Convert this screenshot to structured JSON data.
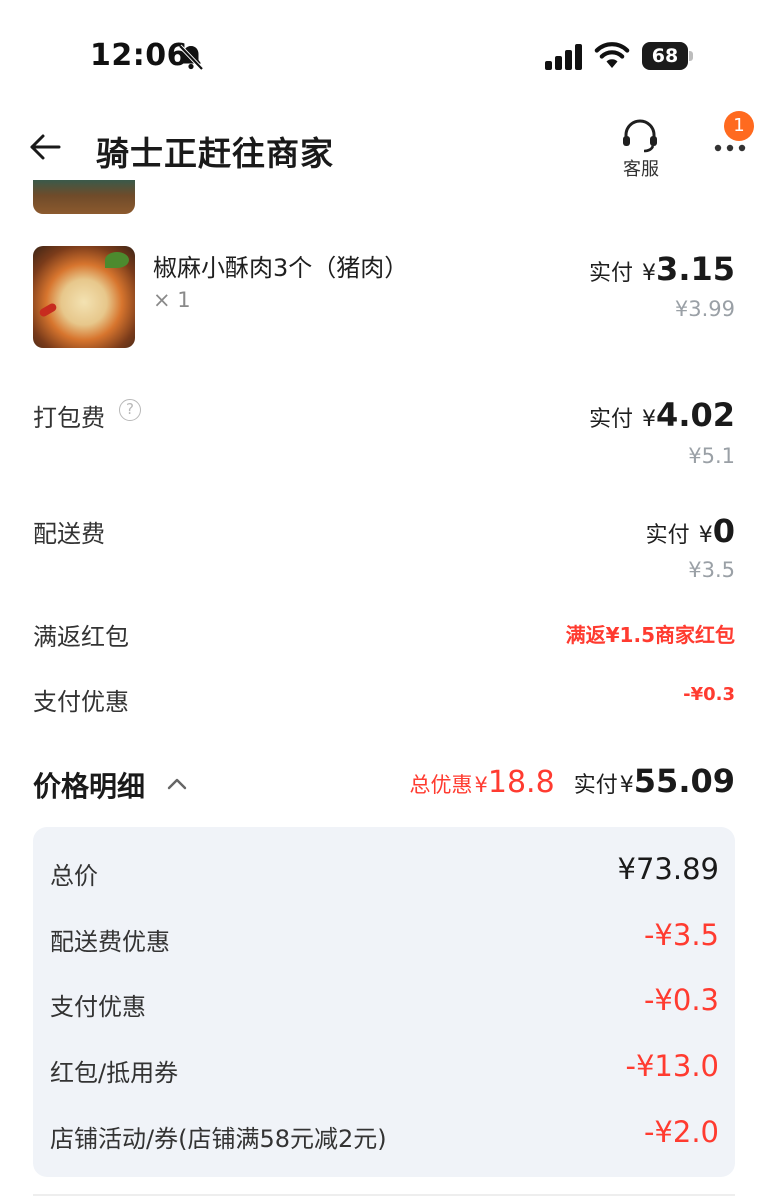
{
  "status_bar": {
    "time": "12:06",
    "battery": "68"
  },
  "header": {
    "title": "骑士正赶往商家",
    "service_label": "客服",
    "notification_count": "1"
  },
  "item": {
    "name": "椒麻小酥肉3个（猪肉）",
    "quantity": "× 1",
    "paid_label": "实付",
    "currency": "¥",
    "paid": "3.15",
    "original": "¥3.99"
  },
  "fees": [
    {
      "label": "打包费",
      "paid_label": "实付",
      "currency": "¥",
      "paid": "4.02",
      "original": "¥5.1"
    },
    {
      "label": "配送费",
      "paid_label": "实付",
      "currency": "¥",
      "paid": "0",
      "original": "¥3.5"
    }
  ],
  "promos": [
    {
      "label": "满返红包",
      "value": "满返¥1.5商家红包"
    },
    {
      "label": "支付优惠",
      "value": "-¥0.3"
    }
  ],
  "price_detail": {
    "title": "价格明细",
    "discount_label": "总优惠",
    "currency": "¥",
    "discount": "18.8",
    "paid_label": "实付",
    "paid": "55.09",
    "rows": [
      {
        "label": "总价",
        "value": "¥73.89"
      },
      {
        "label": "配送费优惠",
        "value": "-¥3.5"
      },
      {
        "label": "支付优惠",
        "value": "-¥0.3"
      },
      {
        "label": "红包/抵用券",
        "value": "-¥13.0"
      },
      {
        "label": "店铺活动/券(店铺满58元减2元)",
        "value": "-¥2.0"
      }
    ]
  },
  "colors": {
    "accent_red": "#ff3b30",
    "badge_orange": "#ff6a1f",
    "panel_bg": "#f0f3f8"
  },
  "icons": [
    "bell-slash-icon",
    "signal-icon",
    "wifi-icon",
    "battery-icon",
    "back-arrow-icon",
    "headset-icon",
    "more-dots-icon",
    "help-icon",
    "chevron-up-icon"
  ]
}
